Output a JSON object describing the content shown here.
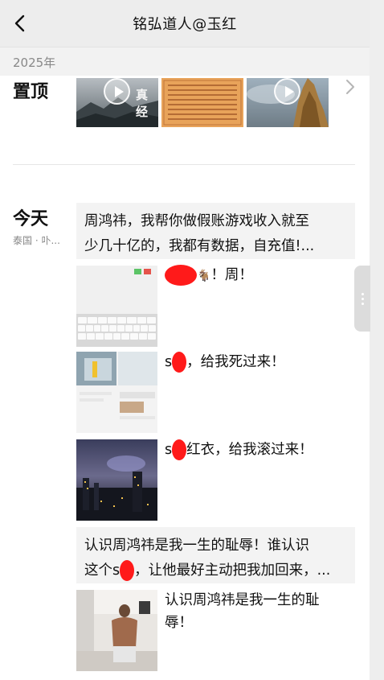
{
  "nav": {
    "title": "铭弘道人@玉红"
  },
  "year_header": "2025年",
  "pinned": {
    "label": "置顶"
  },
  "today": {
    "label": "今天",
    "location": "泰国 · 卟..."
  },
  "posts": [
    {
      "lines": [
        "周鸿祎，我帮你做假账游戏收入就至",
        "少几十亿的，我都有数据，自充值!..."
      ]
    },
    {
      "caption_end": "！周！"
    },
    {
      "caption_pre": "s",
      "caption_post": "，给我死过来！"
    },
    {
      "caption_pre": "s",
      "caption_post": "红衣，给我滚过来！"
    },
    {
      "line1": "认识周鸿祎是我一生的耻辱！谁认识",
      "line2_pre": "这个s",
      "line2_post": "，让他最好主动把我加回来，..."
    },
    {
      "caption_line1": "认识周鸿祎是我一生的耻",
      "caption_line2": "辱！"
    }
  ]
}
